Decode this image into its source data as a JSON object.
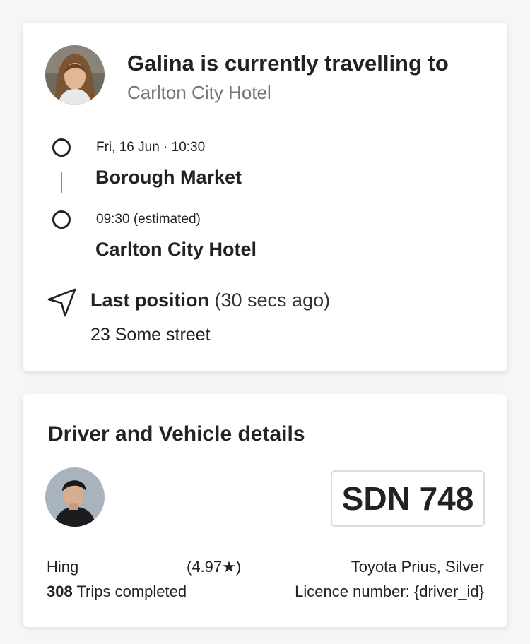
{
  "trip": {
    "title": "Galina is currently travelling to",
    "subtitle": "Carlton City Hotel",
    "stops": [
      {
        "time": "Fri, 16 Jun · 10:30",
        "name": "Borough Market"
      },
      {
        "time": "09:30 (estimated)",
        "name": "Carlton City Hotel"
      }
    ],
    "last_position": {
      "label": "Last position",
      "ago": "(30 secs ago)",
      "street": "23 Some street"
    }
  },
  "driver": {
    "heading": "Driver and Vehicle details",
    "plate": "SDN 748",
    "name": "Hing",
    "rating": "(4.97★)",
    "trips_count": "308",
    "trips_label": "Trips completed",
    "vehicle": "Toyota Prius, Silver",
    "licence": "Licence number: {driver_id}"
  },
  "icons": {
    "navigation": "navigation-arrow-icon",
    "stop": "circle-outline-icon"
  }
}
